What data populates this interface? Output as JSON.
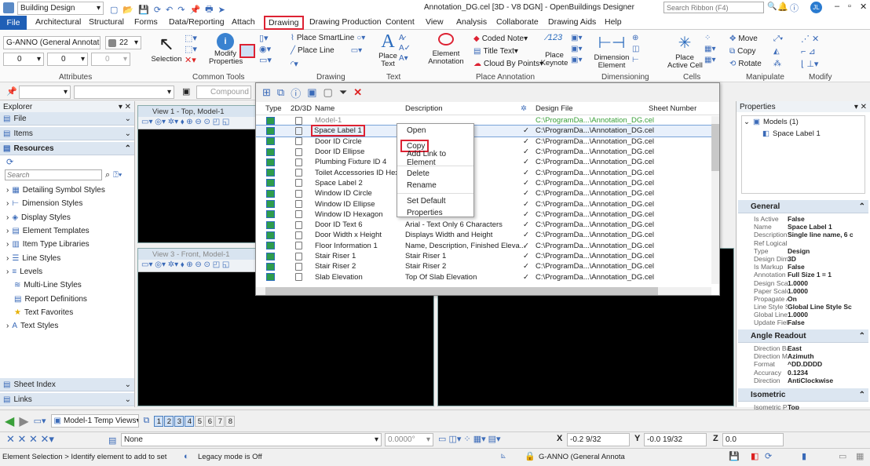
{
  "titlebar": {
    "workspace": "Building Design",
    "title": "Annotation_DG.cel [3D - V8 DGN] - OpenBuildings Designer",
    "search_placeholder": "Search Ribbon (F4)",
    "user_initials": "JL"
  },
  "tabs": [
    "File",
    "Architectural",
    "Structural",
    "Forms",
    "Data/Reporting",
    "Attach",
    "Drawing",
    "Drawing Production",
    "Content",
    "View",
    "Analysis",
    "Collaborate",
    "Drawing Aids",
    "Help"
  ],
  "active_tab": "Drawing",
  "attributes": {
    "level": "G-ANNO (General Annotation",
    "color": "22",
    "weight": "0",
    "style": "0",
    "transparency": "0",
    "label": "Attributes"
  },
  "ribbon_groups": [
    "Attributes",
    "Common Tools",
    "Drawing",
    "Text",
    "Place Annotation",
    "Dimensioning",
    "Cells",
    "Manipulate",
    "Modify"
  ],
  "ribbon_buttons": {
    "selection": "Selection",
    "modify_properties": "Modify\nProperties",
    "place_smartline": "Place SmartLine",
    "place_line": "Place Line",
    "place_text": "Place\nText",
    "element_annotation": "Element\nAnnotation",
    "coded_note": "Coded Note",
    "title_text": "Title Text",
    "cloud_by_points": "Cloud By Points",
    "place_keynote": "Place\nKeynote",
    "dimension_element": "Dimension\nElement",
    "place_active_cell": "Place\nActive Cell",
    "move": "Move",
    "copy": "Copy",
    "rotate": "Rotate"
  },
  "toolbar2": {
    "compound": "Compound"
  },
  "explorer": {
    "title": "Explorer",
    "sections": [
      "File",
      "Items",
      "Resources"
    ],
    "search_placeholder": "Search",
    "items": [
      "Detailing Symbol Styles",
      "Dimension Styles",
      "Display Styles",
      "Element Templates",
      "Item Type Libraries",
      "Line Styles",
      "Levels",
      "Multi-Line Styles",
      "Report Definitions",
      "Text Favorites",
      "Text Styles"
    ],
    "bottom": [
      "Sheet Index",
      "Links"
    ]
  },
  "views": {
    "view1": "View 1 - Top, Model-1",
    "view3": "View 3 - Front, Model-1"
  },
  "dialog": {
    "columns": [
      "Type",
      "2D/3D",
      "Name",
      "Description",
      "Design File",
      "Sheet Number"
    ],
    "rows": [
      {
        "name": "Model-1",
        "desc": "",
        "file": "C:\\ProgramDa...\\Annotation_DG.cel",
        "check": ""
      },
      {
        "name": "Space Label 1",
        "desc": "racter number",
        "file": "C:\\ProgramDa...\\Annotation_DG.cel",
        "check": "✓"
      },
      {
        "name": "Door ID Circle",
        "desc": "",
        "file": "C:\\ProgramDa...\\Annotation_DG.cel",
        "check": "✓"
      },
      {
        "name": "Door ID Ellipse",
        "desc": "",
        "file": "C:\\ProgramDa...\\Annotation_DG.cel",
        "check": "✓"
      },
      {
        "name": "Plumbing Fixture ID 4",
        "desc": "",
        "file": "C:\\ProgramDa...\\Annotation_DG.cel",
        "check": "✓"
      },
      {
        "name": "Toilet Accessories ID Hex...",
        "desc": "ries ID",
        "file": "C:\\ProgramDa...\\Annotation_DG.cel",
        "check": "✓"
      },
      {
        "name": "Space Label 2",
        "desc": "racter nu...",
        "file": "C:\\ProgramDa...\\Annotation_DG.cel",
        "check": "✓"
      },
      {
        "name": "Window ID Circle",
        "desc": "",
        "file": "C:\\ProgramDa...\\Annotation_DG.cel",
        "check": "✓"
      },
      {
        "name": "Window ID Ellipse",
        "desc": "",
        "file": "C:\\ProgramDa...\\Annotation_DG.cel",
        "check": "✓"
      },
      {
        "name": "Window ID Hexagon",
        "desc": "",
        "file": "C:\\ProgramDa...\\Annotation_DG.cel",
        "check": "✓"
      },
      {
        "name": "Door ID Text 6",
        "desc": "Arial - Text Only 6 Characters",
        "file": "C:\\ProgramDa...\\Annotation_DG.cel",
        "check": "✓"
      },
      {
        "name": "Door Width x Height",
        "desc": "Displays Width and Height",
        "file": "C:\\ProgramDa...\\Annotation_DG.cel",
        "check": "✓"
      },
      {
        "name": "Floor Information 1",
        "desc": "Name, Description, Finished Eleva...",
        "file": "C:\\ProgramDa...\\Annotation_DG.cel",
        "check": "✓"
      },
      {
        "name": "Stair Riser 1",
        "desc": "Stair Riser 1",
        "file": "C:\\ProgramDa...\\Annotation_DG.cel",
        "check": "✓"
      },
      {
        "name": "Stair Riser 2",
        "desc": "Stair Riser 2",
        "file": "C:\\ProgramDa...\\Annotation_DG.cel",
        "check": "✓"
      },
      {
        "name": "Slab Elevation",
        "desc": "Top Of Slab Elevation",
        "file": "C:\\ProgramDa...\\Annotation_DG.cel",
        "check": "✓"
      }
    ]
  },
  "context_menu": [
    "Open",
    "Copy",
    "Add Link to Element",
    "Delete",
    "Rename",
    "Set Default",
    "Properties"
  ],
  "properties": {
    "title": "Properties",
    "tree_root": "Models (1)",
    "tree_child": "Space Label 1",
    "general_title": "General",
    "general": [
      [
        "Is Active",
        "False"
      ],
      [
        "Name",
        "Space Label 1"
      ],
      [
        "Description",
        "Single line name, 6 c"
      ],
      [
        "Ref Logical",
        ""
      ],
      [
        "Type",
        "Design"
      ],
      [
        "Design Dime",
        "3D"
      ],
      [
        "Is Markup",
        "False"
      ],
      [
        "Annotation S",
        "Full Size 1 = 1"
      ],
      [
        "Design Scal",
        "1.0000"
      ],
      [
        "Paper Scale",
        "1.0000"
      ],
      [
        "Propagate A",
        "On"
      ],
      [
        "Line Style S",
        "Global Line Style Sc"
      ],
      [
        "Global Line",
        "1.0000"
      ],
      [
        "Update Field",
        "False"
      ]
    ],
    "angle_title": "Angle Readout",
    "angle": [
      [
        "Direction Ba",
        "East"
      ],
      [
        "Direction M",
        "Azimuth"
      ],
      [
        "Format",
        "^DD.DDDD"
      ],
      [
        "Accuracy",
        "0.1234"
      ],
      [
        "Direction",
        "AntiClockwise"
      ]
    ],
    "iso_title": "Isometric",
    "iso": [
      [
        "Isometric Pl",
        "Top"
      ]
    ]
  },
  "bottombar": {
    "temp_views": "Model-1 Temp Views",
    "view_numbers": [
      "1",
      "2",
      "3",
      "4",
      "5",
      "6",
      "7",
      "8"
    ],
    "none": "None",
    "angle": "0.0000°",
    "x_label": "X",
    "x": "-0.2 9/32",
    "y_label": "Y",
    "y": "-0.0 19/32",
    "z_label": "Z",
    "z": "0.0"
  },
  "status": {
    "prompt": "Element Selection > Identify element to add to set",
    "legacy": "Legacy mode is Off",
    "level": "G-ANNO (General Annota"
  }
}
